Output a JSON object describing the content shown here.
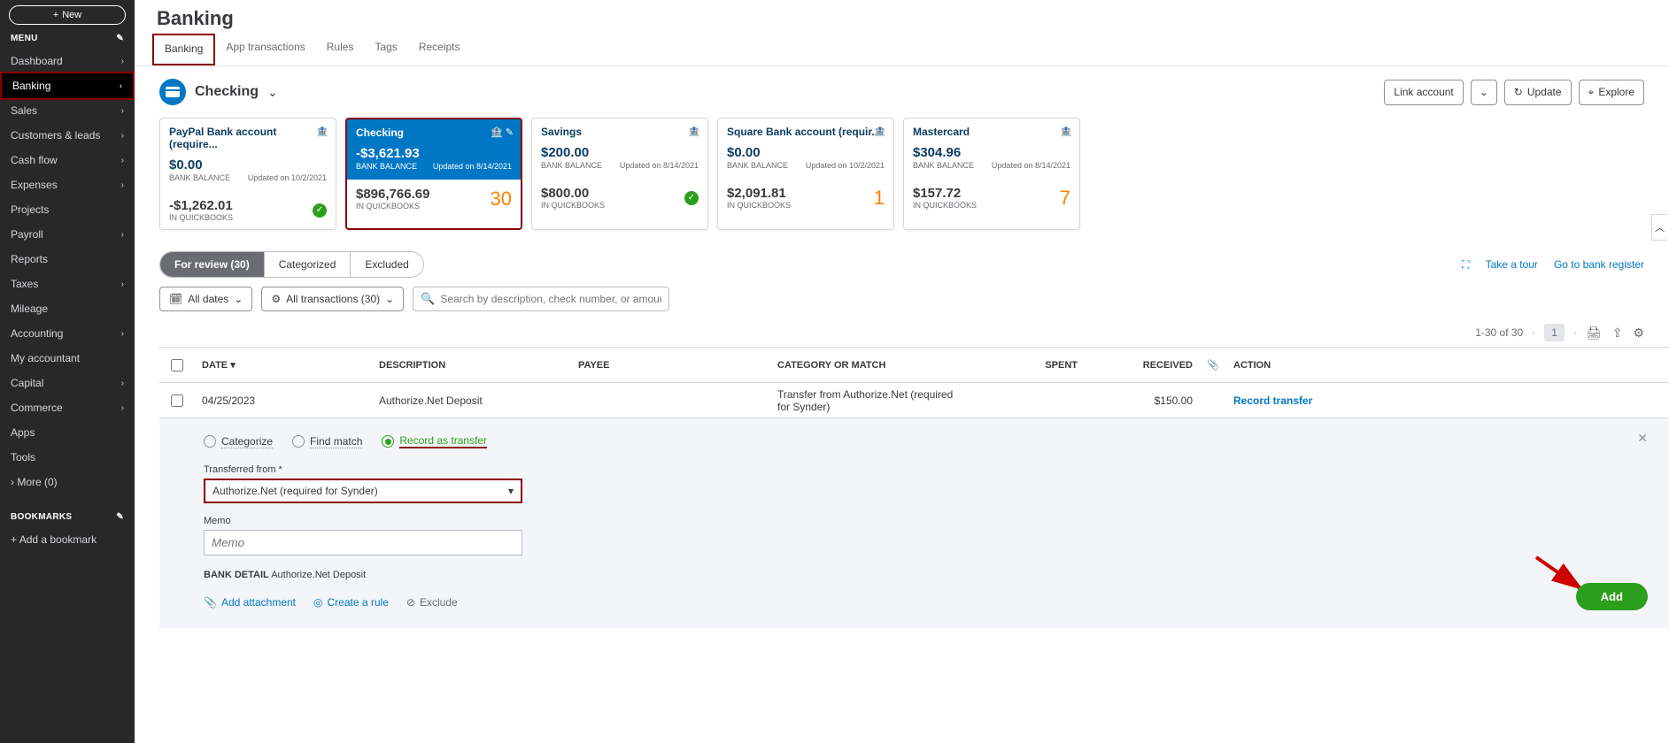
{
  "sidebar": {
    "new_label": "New",
    "menu_header": "MENU",
    "items": [
      {
        "label": "Dashboard",
        "chevron": true
      },
      {
        "label": "Banking",
        "chevron": true,
        "selected": true
      },
      {
        "label": "Sales",
        "chevron": true
      },
      {
        "label": "Customers & leads",
        "chevron": true
      },
      {
        "label": "Cash flow",
        "chevron": true
      },
      {
        "label": "Expenses",
        "chevron": true
      },
      {
        "label": "Projects",
        "chevron": false
      },
      {
        "label": "Payroll",
        "chevron": true
      },
      {
        "label": "Reports",
        "chevron": false
      },
      {
        "label": "Taxes",
        "chevron": true
      },
      {
        "label": "Mileage",
        "chevron": false
      },
      {
        "label": "Accounting",
        "chevron": true
      },
      {
        "label": "My accountant",
        "chevron": false
      },
      {
        "label": "Capital",
        "chevron": true
      },
      {
        "label": "Commerce",
        "chevron": true
      },
      {
        "label": "Apps",
        "chevron": false
      },
      {
        "label": "Tools",
        "chevron": false
      },
      {
        "label": "More (0)",
        "chevron": false,
        "more": true
      }
    ],
    "bookmarks_header": "BOOKMARKS",
    "add_bookmark": "Add a bookmark"
  },
  "page": {
    "title": "Banking",
    "tabs": [
      "Banking",
      "App transactions",
      "Rules",
      "Tags",
      "Receipts"
    ],
    "active_tab": 0
  },
  "account_header": {
    "name": "Checking",
    "link_account": "Link account",
    "update": "Update",
    "explore": "Explore"
  },
  "cards": [
    {
      "name": "PayPal Bank account (require...",
      "balance": "$0.00",
      "balance_label": "BANK BALANCE",
      "updated": "Updated on 10/2/2021",
      "qb": "-$1,262.01",
      "qb_label": "IN QUICKBOOKS",
      "status": "check"
    },
    {
      "name": "Checking",
      "balance": "-$3,621.93",
      "balance_label": "BANK BALANCE",
      "updated": "Updated on 8/14/2021",
      "qb": "$896,766.69",
      "qb_label": "IN QUICKBOOKS",
      "count": "30",
      "active": true
    },
    {
      "name": "Savings",
      "balance": "$200.00",
      "balance_label": "BANK BALANCE",
      "updated": "Updated on 8/14/2021",
      "qb": "$800.00",
      "qb_label": "IN QUICKBOOKS",
      "status": "check"
    },
    {
      "name": "Square Bank account (requir...",
      "balance": "$0.00",
      "balance_label": "BANK BALANCE",
      "updated": "Updated on 10/2/2021",
      "qb": "$2,091.81",
      "qb_label": "IN QUICKBOOKS",
      "count": "1"
    },
    {
      "name": "Mastercard",
      "balance": "$304.96",
      "balance_label": "BANK BALANCE",
      "updated": "Updated on 8/14/2021",
      "qb": "$157.72",
      "qb_label": "IN QUICKBOOKS",
      "count": "7"
    }
  ],
  "segments": {
    "review": "For review (30)",
    "categorized": "Categorized",
    "excluded": "Excluded"
  },
  "quick_links": {
    "tour": "Take a tour",
    "register": "Go to bank register"
  },
  "filters": {
    "dates": "All dates",
    "transactions": "All transactions (30)",
    "search_placeholder": "Search by description, check number, or amount"
  },
  "pagination": {
    "range": "1-30 of 30",
    "page": "1"
  },
  "table": {
    "headers": {
      "date": "DATE",
      "desc": "DESCRIPTION",
      "payee": "PAYEE",
      "cat": "CATEGORY OR MATCH",
      "spent": "SPENT",
      "recv": "RECEIVED",
      "action": "ACTION"
    },
    "row": {
      "date": "04/25/2023",
      "desc": "Authorize.Net Deposit",
      "payee": "",
      "cat": "Transfer from Authorize.Net (required for Synder)",
      "spent": "",
      "recv": "$150.00",
      "action": "Record transfer"
    }
  },
  "detail": {
    "radios": {
      "categorize": "Categorize",
      "find_match": "Find match",
      "transfer": "Record as transfer"
    },
    "transferred_from_label": "Transferred from *",
    "transferred_from_value": "Authorize.Net (required for Synder)",
    "memo_label": "Memo",
    "memo_placeholder": "Memo",
    "bank_detail_label": "BANK DETAIL",
    "bank_detail_value": "Authorize.Net Deposit",
    "add_attachment": "Add attachment",
    "create_rule": "Create a rule",
    "exclude": "Exclude",
    "add_button": "Add"
  }
}
